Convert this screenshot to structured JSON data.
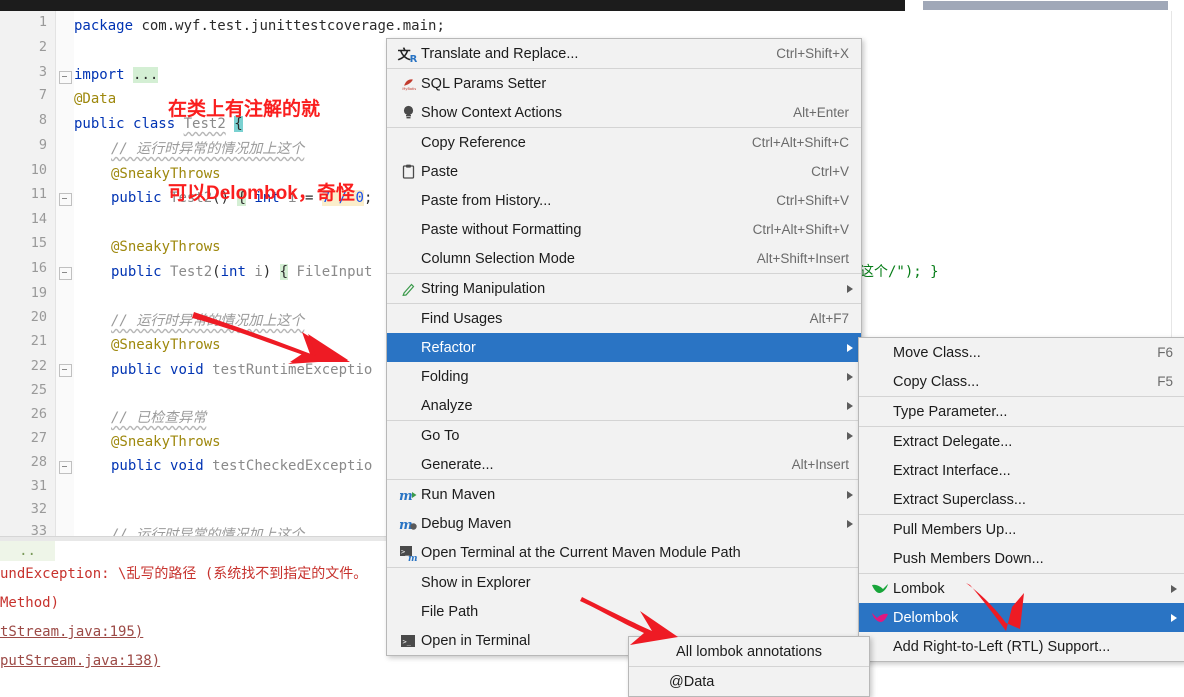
{
  "window": {
    "title": "IntelliJ IDEA editor with context menu"
  },
  "editor": {
    "line_numbers": [
      "1",
      "2",
      "3",
      "7",
      "8",
      "9",
      "10",
      "11",
      "14",
      "15",
      "16",
      "19",
      "20",
      "21",
      "22",
      "25",
      "26",
      "27",
      "28",
      "31",
      "32",
      "33"
    ],
    "code_lines": [
      {
        "n": "1",
        "text": "package com.wyf.test.junittestcoverage.main;"
      },
      {
        "n": "2",
        "text": ""
      },
      {
        "n": "3",
        "text": "import ..."
      },
      {
        "n": "7",
        "text": "@Data"
      },
      {
        "n": "8",
        "text": "public class Test2 {"
      },
      {
        "n": "9",
        "text": "    // 运行时异常的情况加上这个"
      },
      {
        "n": "10",
        "text": "    @SneakyThrows"
      },
      {
        "n": "11",
        "text": "    public Test2() { int i = 7 / 0;"
      },
      {
        "n": "14",
        "text": ""
      },
      {
        "n": "15",
        "text": "    @SneakyThrows"
      },
      {
        "n": "16",
        "text": "    public Test2(int i) { FileInput"
      },
      {
        "n": "19",
        "text": ""
      },
      {
        "n": "20",
        "text": "    // 运行时异常的情况加上这个"
      },
      {
        "n": "21",
        "text": "    @SneakyThrows"
      },
      {
        "n": "22",
        "text": "    public void testRuntimeExceptio"
      },
      {
        "n": "25",
        "text": ""
      },
      {
        "n": "26",
        "text": "    // 已检查异常"
      },
      {
        "n": "27",
        "text": "    @SneakyThrows"
      },
      {
        "n": "28",
        "text": "    public void testCheckedExceptio"
      },
      {
        "n": "31",
        "text": ""
      },
      {
        "n": "32",
        "text": ""
      },
      {
        "n": "33",
        "text": "    // 运行时异常的情况加上这个"
      }
    ],
    "right_fragment": "这个/\"); }",
    "tokens": {
      "package": "package",
      "package_path": "com.wyf.test.junittestcoverage.main;",
      "import": "import",
      "import_dots": "...",
      "data_annotation": "@Data",
      "public": "public",
      "class": "class",
      "class_name": "Test2",
      "open_brace": "{",
      "comment_runtime": "// 运行时异常的情况加上这个",
      "comment_checked": "// 已检查异常",
      "sneaky": "@SneakyThrows",
      "ctor_nullary": "public Test2() { int i = 7 / 0;",
      "ctor_arg": "public Test2(int i) { FileInput",
      "m_runtime": "public void testRuntimeExceptio",
      "m_checked": "public void testCheckedExceptio"
    }
  },
  "annotation_note": {
    "line1": "在类上有注解的就",
    "line2": "可以Delombok，奇怪",
    "color": "#fa1e1e"
  },
  "console": {
    "gutter_dots": "..",
    "lines": [
      {
        "text": "undException: \\乱写的路径 (系统找不到指定的文件。",
        "link": false
      },
      {
        "text": "Method)",
        "link": false
      },
      {
        "text": "tStream.java:195)",
        "link": true
      },
      {
        "text": "putStream.java:138)",
        "link": true
      }
    ]
  },
  "context_menu": {
    "items": [
      {
        "label": "Translate and Replace...",
        "accel": "Ctrl+Shift+X",
        "icon": "translate-icon",
        "submenu": false,
        "selected": false,
        "sep_after": true
      },
      {
        "label": "SQL Params Setter",
        "accel": "",
        "icon": "mybatis-icon",
        "submenu": false,
        "selected": false,
        "sep_after": false
      },
      {
        "label": "Show Context Actions",
        "accel": "Alt+Enter",
        "icon": "lightbulb-icon",
        "submenu": false,
        "selected": false,
        "sep_after": true
      },
      {
        "label": "Copy Reference",
        "accel": "Ctrl+Alt+Shift+C",
        "icon": "",
        "submenu": false,
        "selected": false,
        "sep_after": false,
        "mnemonic": "y"
      },
      {
        "label": "Paste",
        "accel": "Ctrl+V",
        "icon": "clipboard-icon",
        "submenu": false,
        "selected": false,
        "sep_after": false,
        "mnemonic": "P"
      },
      {
        "label": "Paste from History...",
        "accel": "Ctrl+Shift+V",
        "icon": "",
        "submenu": false,
        "selected": false,
        "sep_after": false,
        "mnemonic": "e"
      },
      {
        "label": "Paste without Formatting",
        "accel": "Ctrl+Alt+Shift+V",
        "icon": "",
        "submenu": false,
        "selected": false,
        "sep_after": false,
        "mnemonic": "w"
      },
      {
        "label": "Column Selection Mode",
        "accel": "Alt+Shift+Insert",
        "icon": "",
        "submenu": false,
        "selected": false,
        "sep_after": true,
        "mnemonic": "M"
      },
      {
        "label": "String Manipulation",
        "accel": "",
        "icon": "pen-icon",
        "submenu": true,
        "selected": false,
        "sep_after": true
      },
      {
        "label": "Find Usages",
        "accel": "Alt+F7",
        "icon": "",
        "submenu": false,
        "selected": false,
        "sep_after": false,
        "mnemonic": "U"
      },
      {
        "label": "Refactor",
        "accel": "",
        "icon": "",
        "submenu": true,
        "selected": true,
        "sep_after": false,
        "mnemonic": "R"
      },
      {
        "label": "Folding",
        "accel": "",
        "icon": "",
        "submenu": true,
        "selected": false,
        "sep_after": false
      },
      {
        "label": "Analyze",
        "accel": "",
        "icon": "",
        "submenu": true,
        "selected": false,
        "sep_after": true,
        "mnemonic": "z"
      },
      {
        "label": "Go To",
        "accel": "",
        "icon": "",
        "submenu": true,
        "selected": false,
        "sep_after": false
      },
      {
        "label": "Generate...",
        "accel": "Alt+Insert",
        "icon": "",
        "submenu": false,
        "selected": false,
        "sep_after": true
      },
      {
        "label": "Run Maven",
        "accel": "",
        "icon": "maven-run-icon",
        "submenu": true,
        "selected": false,
        "sep_after": false
      },
      {
        "label": "Debug Maven",
        "accel": "",
        "icon": "maven-debug-icon",
        "submenu": true,
        "selected": false,
        "sep_after": false
      },
      {
        "label": "Open Terminal at the Current Maven Module Path",
        "accel": "",
        "icon": "maven-terminal-icon",
        "submenu": false,
        "selected": false,
        "sep_after": true
      },
      {
        "label": "Show in Explorer",
        "accel": "",
        "icon": "",
        "submenu": false,
        "selected": false,
        "sep_after": false
      },
      {
        "label": "File Path",
        "accel": "",
        "icon": "",
        "submenu": false,
        "selected": false,
        "sep_after": false,
        "mnemonic": "P"
      },
      {
        "label": "Open in Terminal",
        "accel": "",
        "icon": "terminal-icon",
        "submenu": false,
        "selected": false,
        "sep_after": true
      }
    ]
  },
  "refactor_submenu": {
    "items": [
      {
        "label": "Move Class...",
        "accel": "F6",
        "submenu": false,
        "selected": false,
        "icon": "",
        "sep_after": false
      },
      {
        "label": "Copy Class...",
        "accel": "F5",
        "submenu": false,
        "selected": false,
        "icon": "",
        "sep_after": true
      },
      {
        "label": "Type Parameter...",
        "accel": "",
        "submenu": false,
        "selected": false,
        "icon": "",
        "sep_after": true,
        "mnemonic": "y"
      },
      {
        "label": "Extract Delegate...",
        "accel": "",
        "submenu": false,
        "selected": false,
        "icon": "",
        "sep_after": false,
        "mnemonic": "D"
      },
      {
        "label": "Extract Interface...",
        "accel": "",
        "submenu": false,
        "selected": false,
        "icon": "",
        "sep_after": false,
        "mnemonic": "I"
      },
      {
        "label": "Extract Superclass...",
        "accel": "",
        "submenu": false,
        "selected": false,
        "icon": "",
        "sep_after": true,
        "mnemonic": "u"
      },
      {
        "label": "Pull Members Up...",
        "accel": "",
        "submenu": false,
        "selected": false,
        "icon": "",
        "sep_after": false,
        "mnemonic": "ll"
      },
      {
        "label": "Push Members Down...",
        "accel": "",
        "submenu": false,
        "selected": false,
        "icon": "",
        "sep_after": true,
        "mnemonic": "sh"
      },
      {
        "label": "Lombok",
        "accel": "",
        "submenu": true,
        "selected": false,
        "icon": "lombok-icon",
        "sep_after": false
      },
      {
        "label": "Delombok",
        "accel": "",
        "submenu": true,
        "selected": true,
        "icon": "delombok-icon",
        "sep_after": false
      },
      {
        "label": "Add Right-to-Left (RTL) Support...",
        "accel": "",
        "submenu": false,
        "selected": false,
        "icon": "",
        "sep_after": false
      }
    ]
  },
  "delombok_submenu": {
    "items": [
      {
        "label": "All lombok annotations"
      },
      {
        "label": "@Data"
      }
    ]
  },
  "colors": {
    "menu_bg": "#f2f2f2",
    "menu_selected": "#2a74c4",
    "arrow_red": "#ee1b24",
    "annotation_red": "#fa1e1e",
    "keyword_blue": "#0033b3",
    "annotation_gold": "#9e880d",
    "string_green": "#067d17",
    "comment_grey": "#9a9a9a",
    "current_line": "#fcfae8"
  }
}
